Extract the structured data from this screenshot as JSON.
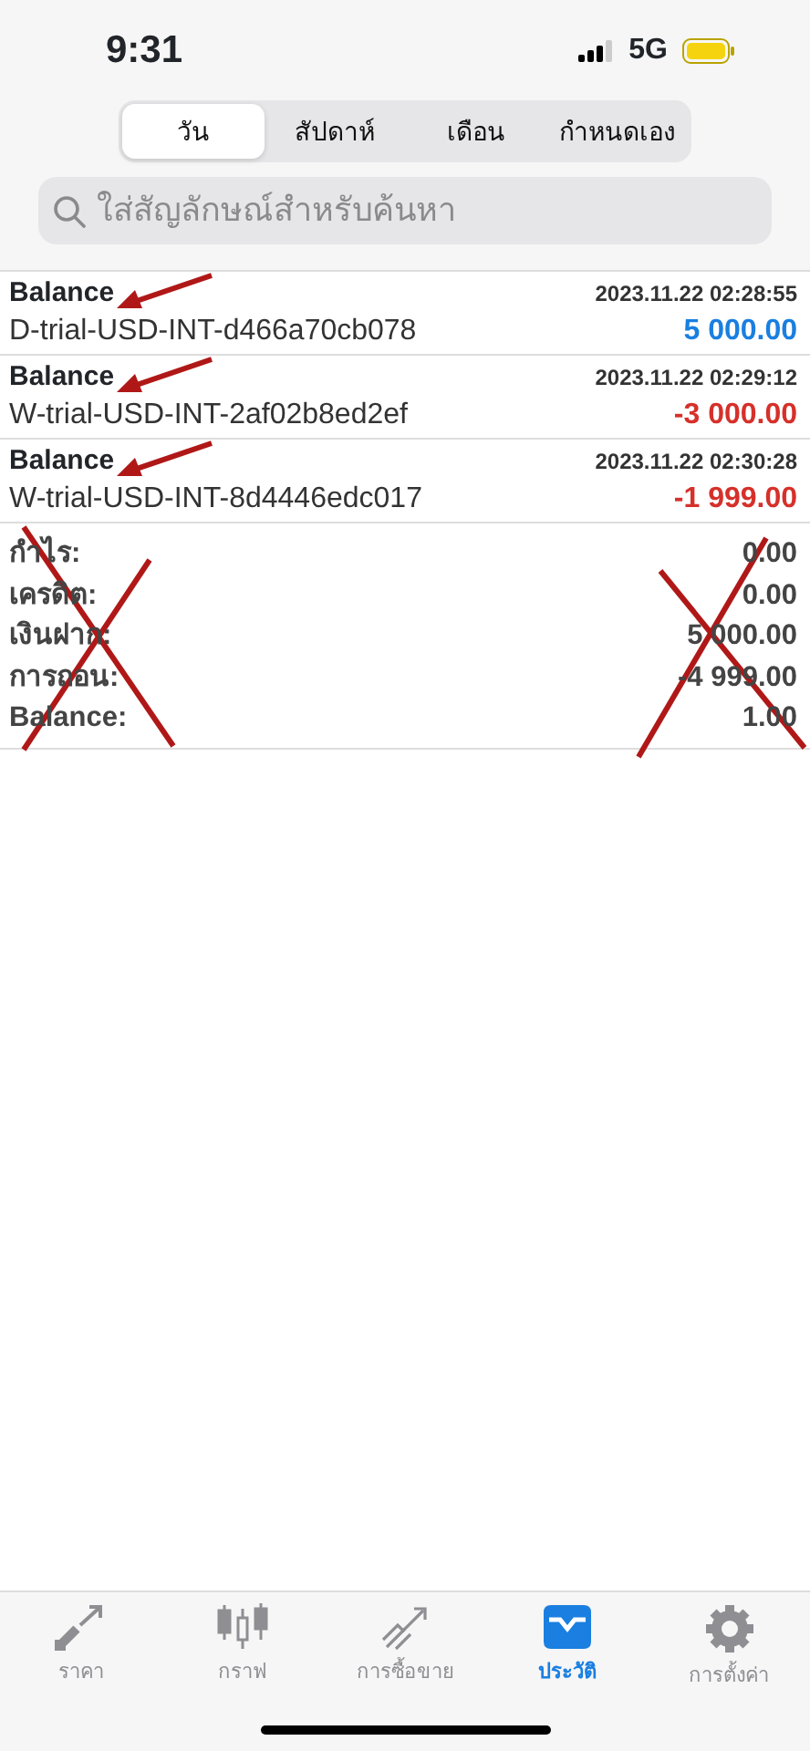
{
  "status_bar": {
    "time": "9:31",
    "network": "5G"
  },
  "tabs": [
    {
      "label": "วัน",
      "selected": true
    },
    {
      "label": "สัปดาห์",
      "selected": false
    },
    {
      "label": "เดือน",
      "selected": false
    },
    {
      "label": "กำหนดเอง",
      "selected": false
    }
  ],
  "search": {
    "placeholder": "ใส่สัญลักษณ์สำหรับค้นหา"
  },
  "deals": [
    {
      "type": "Balance",
      "time": "2023.11.22 02:28:55",
      "comment": "D-trial-USD-INT-d466a70cb078",
      "amount": "5 000.00",
      "color": "#1a7fe0",
      "arrow_mark": true
    },
    {
      "type": "Balance",
      "time": "2023.11.22 02:29:12",
      "comment": "W-trial-USD-INT-2af02b8ed2ef",
      "amount": "-3 000.00",
      "color": "#d6302a",
      "arrow_mark": true
    },
    {
      "type": "Balance",
      "time": "2023.11.22 02:30:28",
      "comment": "W-trial-USD-INT-8d4446edc017",
      "amount": "-1 999.00",
      "color": "#d6302a",
      "arrow_mark": true
    }
  ],
  "summary": {
    "crossed_out": true,
    "rows": [
      {
        "label": "กำไร:",
        "value": "0.00"
      },
      {
        "label": "เครดิต:",
        "value": "0.00"
      },
      {
        "label": "เงินฝาก:",
        "value": "5 000.00"
      },
      {
        "label": "การถอน:",
        "value": "-4 999.00"
      },
      {
        "label": "Balance:",
        "value": "1.00"
      }
    ]
  },
  "tab_bar": [
    {
      "label": "ราคา",
      "kind": "quotes",
      "selected": false
    },
    {
      "label": "กราฟ",
      "kind": "chart",
      "selected": false
    },
    {
      "label": "การซื้อขาย",
      "kind": "trade",
      "selected": false
    },
    {
      "label": "ประวัติ",
      "kind": "history",
      "selected": true
    },
    {
      "label": "การตั้งค่า",
      "kind": "settings",
      "selected": false
    }
  ]
}
